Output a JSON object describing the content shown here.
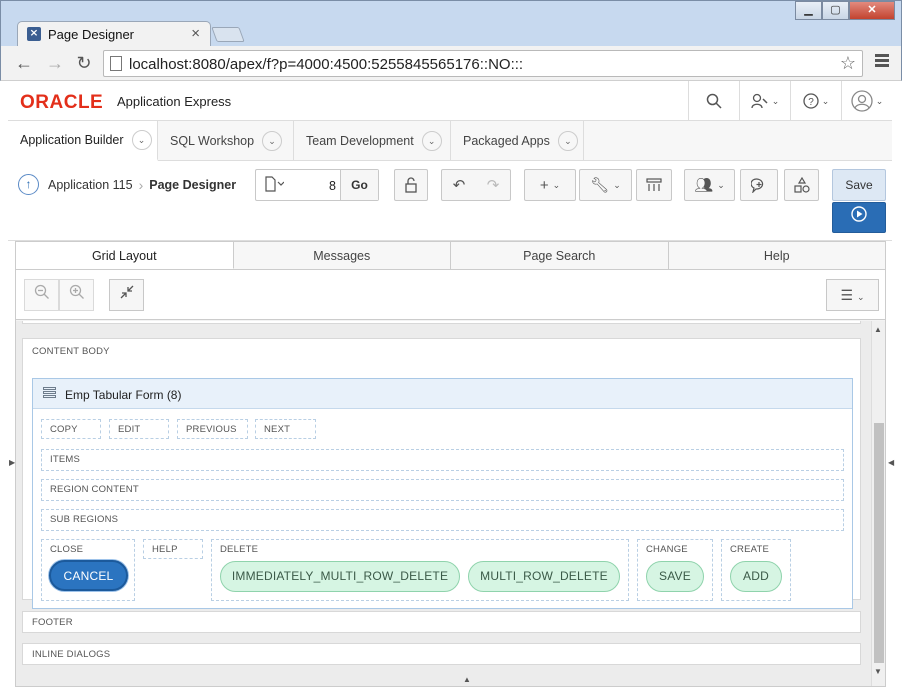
{
  "browser": {
    "tab_title": "Page Designer",
    "tab_close": "×",
    "url": "localhost:8080/apex/f?p=4000:4500:5255845565176::NO:::",
    "window_buttons": [
      "▁",
      "▢",
      "✕"
    ]
  },
  "header": {
    "logo": "ORACLE",
    "product": "Application Express"
  },
  "apex_tabs": [
    {
      "label": "Application Builder"
    },
    {
      "label": "SQL Workshop"
    },
    {
      "label": "Team Development"
    },
    {
      "label": "Packaged Apps"
    }
  ],
  "breadcrumb": {
    "parent": "Application 115",
    "current": "Page Designer"
  },
  "page_selector": {
    "value": "8",
    "go_label": "Go"
  },
  "actions": {
    "save_label": "Save"
  },
  "pane_tabs": [
    {
      "label": "Grid Layout"
    },
    {
      "label": "Messages"
    },
    {
      "label": "Page Search"
    },
    {
      "label": "Help"
    }
  ],
  "layout": {
    "content_body": "CONTENT BODY",
    "region_title": "Emp Tabular Form (8)",
    "button_slots": [
      "COPY",
      "EDIT",
      "PREVIOUS",
      "NEXT"
    ],
    "items": "ITEMS",
    "region_content": "REGION CONTENT",
    "sub_regions": "SUB REGIONS",
    "close": "CLOSE",
    "help": "HELP",
    "delete": "DELETE",
    "change": "CHANGE",
    "create": "CREATE",
    "footer": "FOOTER",
    "inline_dialogs": "INLINE DIALOGS",
    "buttons": {
      "cancel": "CANCEL",
      "immediate_delete": "IMMEDIATELY_MULTI_ROW_DELETE",
      "multi_delete": "MULTI_ROW_DELETE",
      "save": "SAVE",
      "add": "ADD"
    }
  }
}
